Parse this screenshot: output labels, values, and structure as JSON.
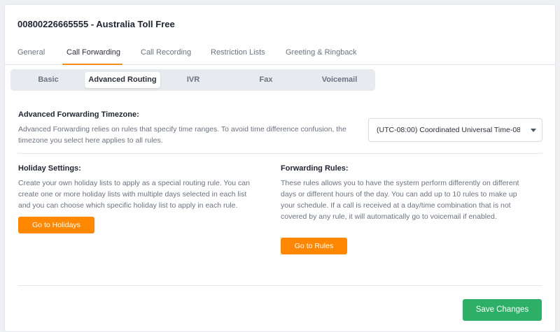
{
  "header": {
    "title": "00800226665555 - Australia Toll Free"
  },
  "tabs": [
    {
      "label": "General",
      "active": false
    },
    {
      "label": "Call Forwarding",
      "active": true
    },
    {
      "label": "Call Recording",
      "active": false
    },
    {
      "label": "Restriction Lists",
      "active": false
    },
    {
      "label": "Greeting & Ringback",
      "active": false
    }
  ],
  "subtabs": [
    {
      "label": "Basic",
      "active": false
    },
    {
      "label": "Advanced Routing",
      "active": true
    },
    {
      "label": "IVR",
      "active": false
    },
    {
      "label": "Fax",
      "active": false
    },
    {
      "label": "Voicemail",
      "active": false
    }
  ],
  "timezone": {
    "label": "Advanced Forwarding Timezone:",
    "description": "Advanced Forwarding relies on rules that specify time ranges. To avoid time difference confusion, the timezone you select here applies to all rules.",
    "selected": "(UTC-08:00) Coordinated Universal Time-08"
  },
  "holiday": {
    "label": "Holiday Settings:",
    "description": "Create your own holiday lists to apply as a special routing rule. You can create one or more holiday lists with multiple days selected in each list and you can choose which specific holiday list to apply in each rule.",
    "button": "Go to Holidays"
  },
  "rules": {
    "label": "Forwarding Rules:",
    "description": "These rules allows you to have the system perform differently on different days or different hours of the day. You can add up to 10 rules to make up your schedule. If a call is received at a day/time combination that is not covered by any rule, it will automatically go to voicemail if enabled.",
    "button": "Go to Rules"
  },
  "footer": {
    "save_label": "Save Changes"
  },
  "colors": {
    "accent_orange": "#ff8800",
    "tab_underline": "#f08c1a",
    "save_green": "#2eaf67"
  }
}
